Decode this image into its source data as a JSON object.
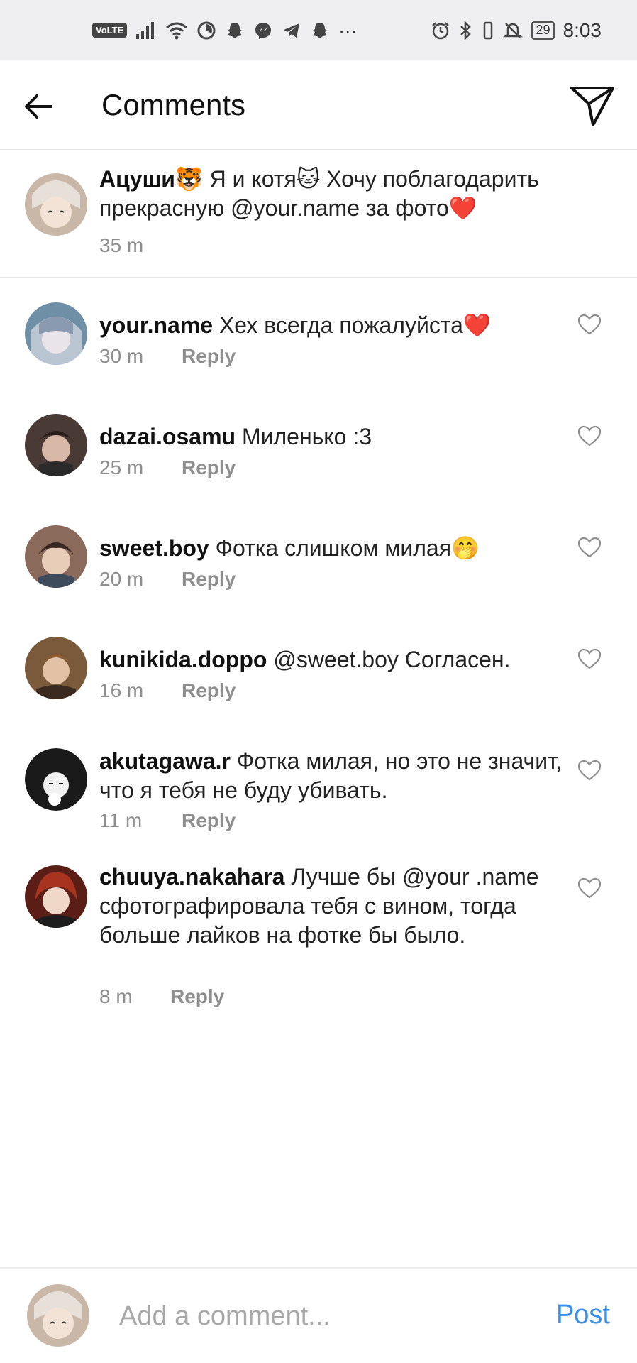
{
  "status_bar": {
    "volte": "VoLTE",
    "more": "···",
    "battery": "29",
    "time": "8:03",
    "icons": [
      "signal-icon",
      "wifi-icon",
      "timer-icon",
      "snapchat-icon",
      "messenger-icon",
      "telegram-icon",
      "snapchat-icon",
      "alarm-icon",
      "bluetooth-icon",
      "mute-icon",
      "battery-icon"
    ]
  },
  "header": {
    "title": "Comments"
  },
  "caption": {
    "username": "Ацуши",
    "text": "🐯 Я и котя🐱 Хочу поблагодарить прекрасную @your.name за фото❤️",
    "time": "35 m",
    "avatar_color": "#c9b8a8"
  },
  "comments": [
    {
      "username": "your.name",
      "text": "Хех всегда пожалуйста❤️",
      "time": "30 m",
      "reply": "Reply",
      "avatar_color": "#6f8fa6"
    },
    {
      "username": "dazai.osamu",
      "text": "Миленько :3",
      "time": "25 m",
      "reply": "Reply",
      "avatar_color": "#4a3a36"
    },
    {
      "username": "sweet.boy",
      "text": "Фотка слишком милая🤭",
      "time": "20 m",
      "reply": "Reply",
      "avatar_color": "#8a6a5a"
    },
    {
      "username": "kunikida.doppo",
      "text": "@sweet.boy Согласен.",
      "time": "16 m",
      "reply": "Reply",
      "avatar_color": "#7a5a3a"
    },
    {
      "username": "akutagawa.r",
      "text": "Фотка милая, но это не значит, что я тебя не буду убивать.",
      "time": "11 m",
      "reply": "Reply",
      "avatar_color": "#1a1a1a"
    },
    {
      "username": "chuuya.nakahara",
      "text": "Лучше бы @your .name сфотографировала тебя с вином, тогда больше лайков на фотке бы было.",
      "time": "8 m",
      "reply": "Reply",
      "avatar_color": "#5a1e16"
    }
  ],
  "composer": {
    "placeholder": "Add a comment...",
    "post_label": "Post",
    "avatar_color": "#c9b8a8"
  },
  "colors": {
    "accent": "#3a8ee8",
    "muted": "#8e8e8e",
    "status_bar": "#efeff1"
  }
}
